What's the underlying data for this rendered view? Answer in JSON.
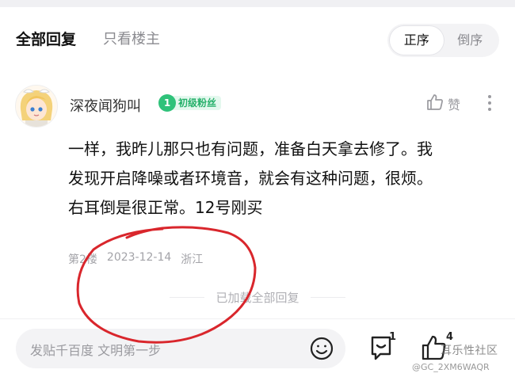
{
  "tabs": {
    "all": "全部回复",
    "op_only": "只看楼主"
  },
  "sort": {
    "asc": "正序",
    "desc": "倒序",
    "active": "asc"
  },
  "post": {
    "username": "深夜闻狗叫",
    "fan_level": "1",
    "fan_label": "初级粉丝",
    "like_label": "赞",
    "content_lines": [
      "一样，我昨儿那只也有问题，准备白天拿去修了。我",
      "发现开启降噪或者环境音，就会有这种问题，很烦。",
      "右耳倒是很正常。12号刚买"
    ],
    "floor": "第2楼",
    "date": "2023-12-14",
    "location": "浙江"
  },
  "footer": {
    "loaded_all": "已加载全部回复",
    "reply_placeholder": "发贴千百度 文明第一步",
    "comment_count": "1",
    "like_count": "4"
  },
  "watermark": {
    "line1": "耳乐性社区",
    "line2": "@GC_2XM6WAQR"
  },
  "colors": {
    "badge_green": "#2fc27a",
    "annotation_red": "#d9262c"
  },
  "icons": [
    "avatar",
    "thumb-up-icon",
    "more-vertical-icon",
    "emoji-icon",
    "comment-icon",
    "thumb-up-icon"
  ]
}
